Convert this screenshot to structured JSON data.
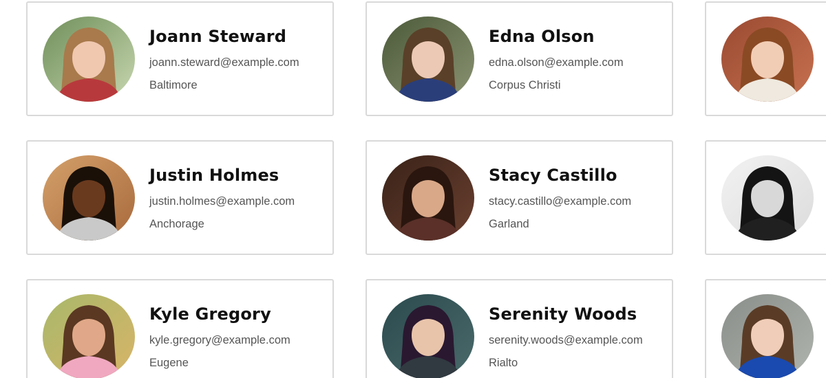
{
  "cards": [
    {
      "name": "Joann Steward",
      "email": "joann.steward@example.com",
      "city": "Baltimore",
      "avatar_icon": "person-photo-avatar",
      "colors": {
        "bg1": "#6f8f5a",
        "bg2": "#c8d7b0",
        "hair": "#a87a4c",
        "skin": "#f0c8b0",
        "shirt": "#b8393c"
      }
    },
    {
      "name": "Edna Olson",
      "email": "edna.olson@example.com",
      "city": "Corpus Christi",
      "avatar_icon": "person-photo-avatar",
      "colors": {
        "bg1": "#4c5a3a",
        "bg2": "#8a9372",
        "hair": "#5a4028",
        "skin": "#ecc9b5",
        "shirt": "#2a3e7a"
      }
    },
    {
      "name": "",
      "email": "",
      "city": "",
      "avatar_icon": "person-photo-avatar",
      "colors": {
        "bg1": "#9a4a32",
        "bg2": "#c7714f",
        "hair": "#8a4a24",
        "skin": "#f2cdb5",
        "shirt": "#efe9df"
      }
    },
    {
      "name": "Justin Holmes",
      "email": "justin.holmes@example.com",
      "city": "Anchorage",
      "avatar_icon": "person-photo-avatar",
      "colors": {
        "bg1": "#d4a06a",
        "bg2": "#a86a3c",
        "hair": "#1a1008",
        "skin": "#6a3a1e",
        "shirt": "#c9c9c9"
      }
    },
    {
      "name": "Stacy Castillo",
      "email": "stacy.castillo@example.com",
      "city": "Garland",
      "avatar_icon": "person-photo-avatar",
      "colors": {
        "bg1": "#3a2218",
        "bg2": "#6a4030",
        "hair": "#2a160e",
        "skin": "#d9a888",
        "shirt": "#5a3028"
      }
    },
    {
      "name": "",
      "email": "",
      "city": "",
      "avatar_icon": "person-photo-avatar",
      "colors": {
        "bg1": "#f2f2f2",
        "bg2": "#dcdcdc",
        "hair": "#141414",
        "skin": "#d8d8d8",
        "shirt": "#202020"
      }
    },
    {
      "name": "Kyle Gregory",
      "email": "kyle.gregory@example.com",
      "city": "Eugene",
      "avatar_icon": "person-photo-avatar",
      "colors": {
        "bg1": "#a8b86a",
        "bg2": "#d8b468",
        "hair": "#5a3822",
        "skin": "#e0a888",
        "shirt": "#f0a8c0"
      }
    },
    {
      "name": "Serenity Woods",
      "email": "serenity.woods@example.com",
      "city": "Rialto",
      "avatar_icon": "person-photo-avatar",
      "colors": {
        "bg1": "#2a4a4e",
        "bg2": "#4a6a6a",
        "hair": "#2a1830",
        "skin": "#e8c4aa",
        "shirt": "#303a40"
      }
    },
    {
      "name": "",
      "email": "",
      "city": "",
      "avatar_icon": "person-photo-avatar",
      "colors": {
        "bg1": "#8a8e8a",
        "bg2": "#b0b4ae",
        "hair": "#5a3c26",
        "skin": "#f0cdb8",
        "shirt": "#1a4ab0"
      }
    }
  ]
}
